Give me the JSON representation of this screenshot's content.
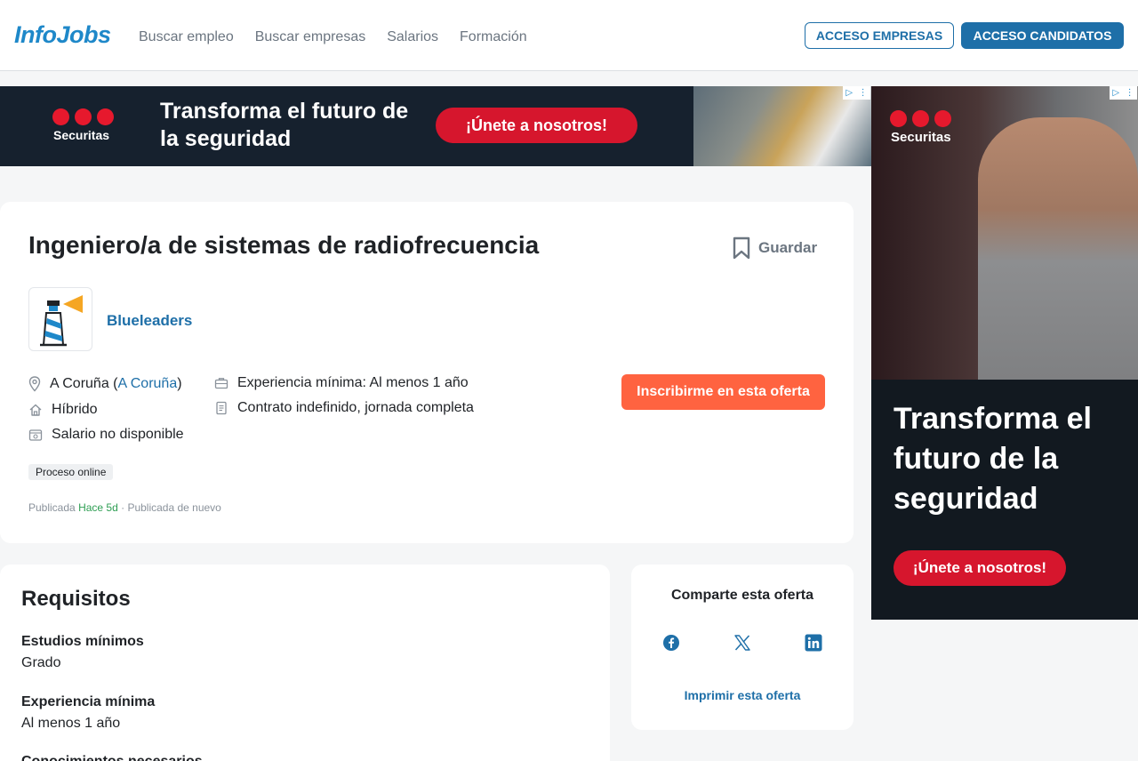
{
  "header": {
    "logo": "InfoJobs",
    "nav": [
      "Buscar empleo",
      "Buscar empresas",
      "Salarios",
      "Formación"
    ],
    "btn_empresas": "ACCESO EMPRESAS",
    "btn_candidatos": "ACCESO CANDIDATOS"
  },
  "ad_top": {
    "brand": "Securitas",
    "headline": "Transforma el futuro de la seguridad",
    "cta": "¡Únete a  nosotros!"
  },
  "job": {
    "title": "Ingeniero/a de sistemas de radiofrecuencia",
    "save_label": "Guardar",
    "company": "Blueleaders",
    "location_city": "A Coruña",
    "location_province": "A Coruña",
    "work_mode": "Híbrido",
    "salary": "Salario no disponible",
    "experience": "Experiencia mínima: Al menos 1 año",
    "contract": "Contrato indefinido, jornada completa",
    "apply_label": "Inscribirme en esta oferta",
    "process_tag": "Proceso online",
    "published_prefix": "Publicada",
    "published_time": "Hace 5d",
    "published_suffix": "· Publicada de nuevo"
  },
  "requirements": {
    "title": "Requisitos",
    "items": [
      {
        "label": "Estudios mínimos",
        "value": "Grado"
      },
      {
        "label": "Experiencia mínima",
        "value": "Al menos 1 año"
      },
      {
        "label": "Conocimientos necesarios",
        "value": ""
      }
    ]
  },
  "share": {
    "title": "Comparte esta oferta",
    "networks": [
      "facebook-icon",
      "x-icon",
      "linkedin-icon"
    ],
    "print_label": "Imprimir esta oferta"
  },
  "ad_side": {
    "brand": "Securitas",
    "headline": "Transforma el futuro de la seguridad",
    "cta": "¡Únete a nosotros!"
  },
  "colors": {
    "brand_blue": "#1e6fa8",
    "apply_orange": "#ff6340",
    "ad_red": "#d6162d",
    "published_green": "#2e9e53"
  }
}
